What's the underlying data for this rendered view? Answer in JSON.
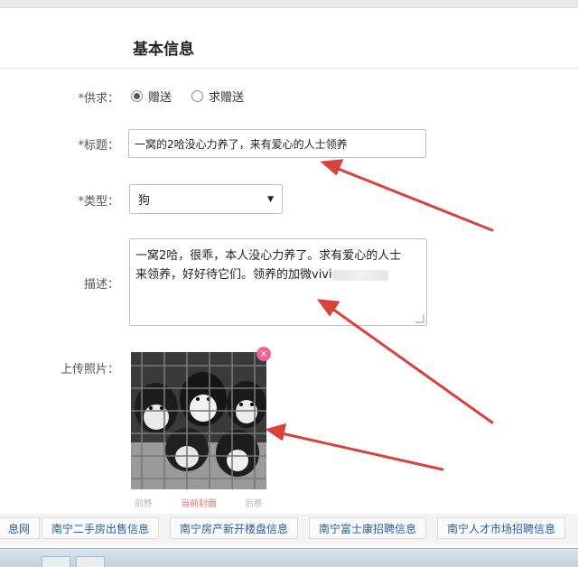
{
  "form": {
    "section_title": "基本信息",
    "supply": {
      "label": "*供求：",
      "options": [
        "赠送",
        "求赠送"
      ],
      "selected": "赠送"
    },
    "title": {
      "label": "*标题：",
      "value": "一窝的2哈没心力养了，来有爱心的人士领养"
    },
    "type": {
      "label": "*类型：",
      "value": "狗"
    },
    "description": {
      "label": "描述：",
      "line1": "一窝2哈，很乖，本人没心力养了。求有爱心的人士",
      "line2": "来领养，好好待它们。领养的加微vivi"
    },
    "photo": {
      "label": "上传照片：",
      "close": "×",
      "actions": [
        "前移",
        "当前封面",
        "后移"
      ]
    }
  },
  "links": [
    "息网",
    "南宁二手房出售信息",
    "南宁房产新开楼盘信息",
    "南宁富士康招聘信息",
    "南宁人才市场招聘信息"
  ],
  "colors": {
    "arrow": "#d9413b",
    "badge": "#f06292",
    "link": "#2a5d9f"
  }
}
